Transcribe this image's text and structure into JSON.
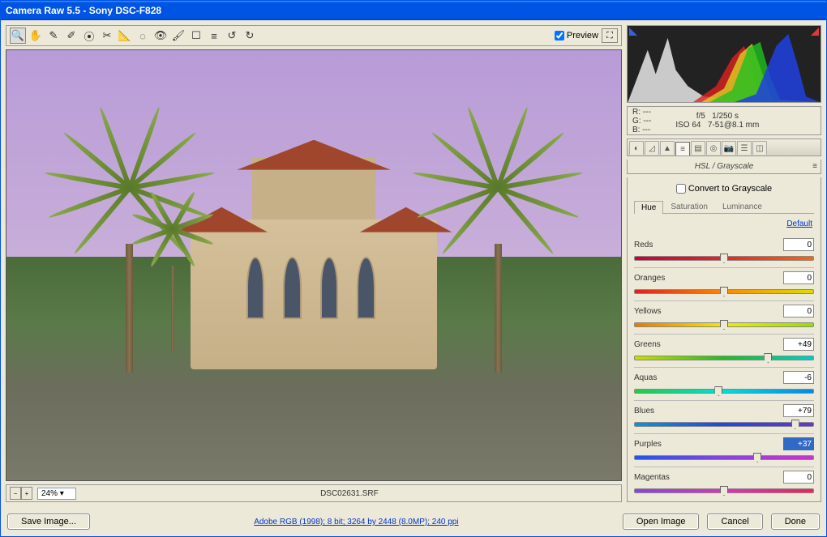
{
  "window": {
    "title": "Camera Raw 5.5  -  Sony DSC-F828"
  },
  "toolbar": {
    "preview_label": "Preview",
    "preview_checked": true,
    "tools": [
      "zoom",
      "hand",
      "white-balance",
      "color-sampler",
      "target",
      "crop",
      "straighten",
      "retouch",
      "redeye",
      "prefs",
      "list",
      "rotate-ccw",
      "rotate-cw"
    ]
  },
  "zoom": {
    "value": "24%"
  },
  "file": {
    "name": "DSC02631.SRF"
  },
  "footer": {
    "save_label": "Save Image...",
    "link": "Adobe RGB (1998); 8 bit; 3264 by 2448 (8.0MP); 240 ppi",
    "open_label": "Open Image",
    "cancel_label": "Cancel",
    "done_label": "Done"
  },
  "exif": {
    "r": "R:  ---",
    "g": "G:  ---",
    "b": "B:  ---",
    "aperture": "f/5",
    "shutter": "1/250 s",
    "iso": "ISO 64",
    "focal": "7-51@8.1 mm"
  },
  "panel": {
    "title": "HSL / Grayscale",
    "grayscale_label": "Convert to Grayscale",
    "grayscale_checked": false,
    "subtabs": [
      "Hue",
      "Saturation",
      "Luminance"
    ],
    "active_subtab": "Hue",
    "default_label": "Default"
  },
  "sliders": [
    {
      "label": "Reds",
      "value": 0,
      "cls": "r-reds"
    },
    {
      "label": "Oranges",
      "value": 0,
      "cls": "r-oranges"
    },
    {
      "label": "Yellows",
      "value": 0,
      "cls": "r-yellows"
    },
    {
      "label": "Greens",
      "value": 49,
      "cls": "r-greens",
      "display": "+49"
    },
    {
      "label": "Aquas",
      "value": -6,
      "cls": "r-aquas"
    },
    {
      "label": "Blues",
      "value": 79,
      "cls": "r-blues",
      "display": "+79"
    },
    {
      "label": "Purples",
      "value": 37,
      "cls": "r-purples",
      "display": "+37",
      "highlight": true
    },
    {
      "label": "Magentas",
      "value": 0,
      "cls": "r-magentas"
    }
  ]
}
